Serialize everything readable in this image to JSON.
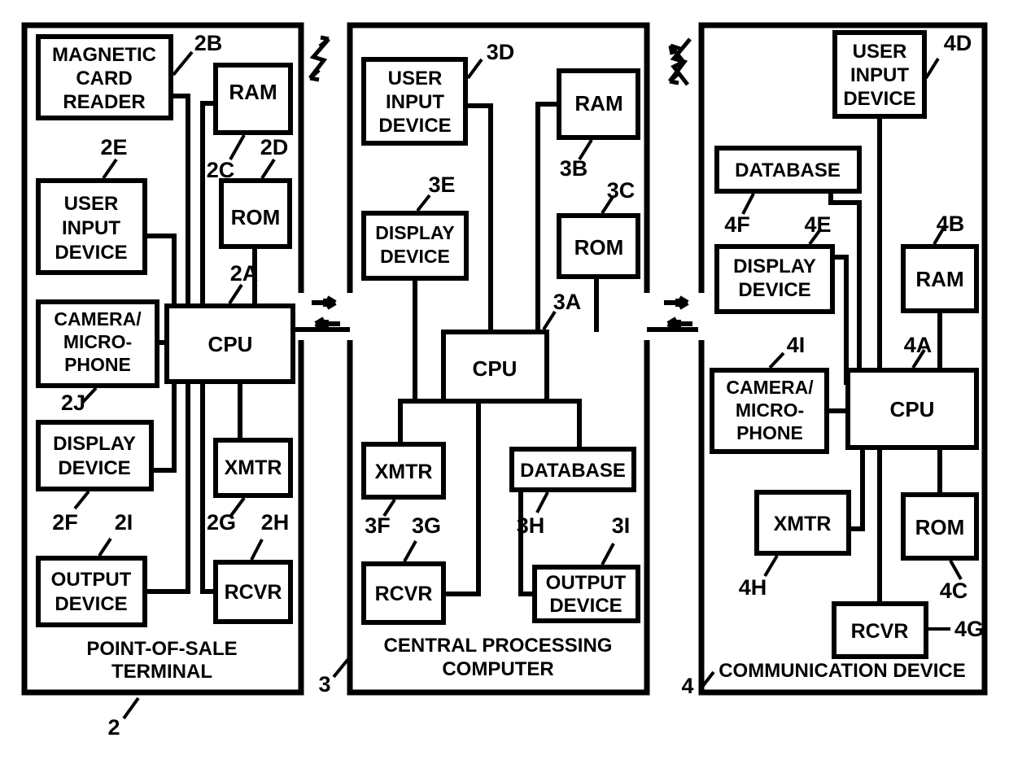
{
  "figure": {
    "type": "patent-block-diagram",
    "title": "",
    "panels": [
      {
        "id": "pos",
        "name": "point-of-sale-terminal",
        "title_lines": [
          "POINT-OF-SALE",
          "TERMINAL"
        ],
        "ref": "2",
        "blocks": [
          {
            "key": "magcard",
            "label_lines": [
              "MAGNETIC",
              "CARD",
              "READER"
            ],
            "ref": "2B"
          },
          {
            "key": "ram",
            "label_lines": [
              "RAM"
            ],
            "ref": "2C"
          },
          {
            "key": "rom",
            "label_lines": [
              "ROM"
            ],
            "ref": "2D"
          },
          {
            "key": "uid",
            "label_lines": [
              "USER",
              "INPUT",
              "DEVICE"
            ],
            "ref": "2E"
          },
          {
            "key": "cpu",
            "label_lines": [
              "CPU"
            ],
            "ref": "2A"
          },
          {
            "key": "cam",
            "label_lines": [
              "CAMERA/",
              "MICRO-",
              "PHONE"
            ],
            "ref": "2J"
          },
          {
            "key": "display",
            "label_lines": [
              "DISPLAY",
              "DEVICE"
            ],
            "ref": "2F"
          },
          {
            "key": "xmtr",
            "label_lines": [
              "XMTR"
            ],
            "ref": "2G"
          },
          {
            "key": "output",
            "label_lines": [
              "OUTPUT",
              "DEVICE"
            ],
            "ref": "2I"
          },
          {
            "key": "rcvr",
            "label_lines": [
              "RCVR"
            ],
            "ref": "2H"
          }
        ]
      },
      {
        "id": "cpc",
        "name": "central-processing-computer",
        "title_lines": [
          "CENTRAL PROCESSING",
          "COMPUTER"
        ],
        "ref": "3",
        "blocks": [
          {
            "key": "uid",
            "label_lines": [
              "USER",
              "INPUT",
              "DEVICE"
            ],
            "ref": "3D"
          },
          {
            "key": "ram",
            "label_lines": [
              "RAM"
            ],
            "ref": "3B"
          },
          {
            "key": "rom",
            "label_lines": [
              "ROM"
            ],
            "ref": "3C"
          },
          {
            "key": "display",
            "label_lines": [
              "DISPLAY",
              "DEVICE"
            ],
            "ref": "3E"
          },
          {
            "key": "cpu",
            "label_lines": [
              "CPU"
            ],
            "ref": "3A"
          },
          {
            "key": "xmtr",
            "label_lines": [
              "XMTR"
            ],
            "ref": "3F"
          },
          {
            "key": "database",
            "label_lines": [
              "DATABASE"
            ],
            "ref": "3H"
          },
          {
            "key": "rcvr",
            "label_lines": [
              "RCVR"
            ],
            "ref": "3G"
          },
          {
            "key": "output",
            "label_lines": [
              "OUTPUT",
              "DEVICE"
            ],
            "ref": "3I"
          }
        ]
      },
      {
        "id": "comm",
        "name": "communication-device",
        "title_lines": [
          "COMMUNICATION DEVICE"
        ],
        "ref": "4",
        "blocks": [
          {
            "key": "uid",
            "label_lines": [
              "USER",
              "INPUT",
              "DEVICE"
            ],
            "ref": "4D"
          },
          {
            "key": "database",
            "label_lines": [
              "DATABASE"
            ],
            "ref": "4F"
          },
          {
            "key": "display",
            "label_lines": [
              "DISPLAY",
              "DEVICE"
            ],
            "ref": "4E"
          },
          {
            "key": "ram",
            "label_lines": [
              "RAM"
            ],
            "ref": "4B"
          },
          {
            "key": "cam",
            "label_lines": [
              "CAMERA/",
              "MICRO-",
              "PHONE"
            ],
            "ref": "4I"
          },
          {
            "key": "cpu",
            "label_lines": [
              "CPU"
            ],
            "ref": "4A"
          },
          {
            "key": "xmtr",
            "label_lines": [
              "XMTR"
            ],
            "ref": "4H"
          },
          {
            "key": "rom",
            "label_lines": [
              "ROM"
            ],
            "ref": "4C"
          },
          {
            "key": "rcvr",
            "label_lines": [
              "RCVR"
            ],
            "ref": "4G"
          }
        ]
      }
    ],
    "links": [
      {
        "name": "pos-to-cpc-wireless",
        "symbol": "lightning-arrow-down-left"
      },
      {
        "name": "pos-to-cpc-wired",
        "symbol": "bidirectional-arrows"
      },
      {
        "name": "cpc-to-comm-wireless",
        "symbol": "lightning-arrow-double"
      },
      {
        "name": "cpc-to-comm-wired",
        "symbol": "bidirectional-arrows"
      }
    ],
    "colors": {
      "ink": "#000000",
      "paper": "#ffffff"
    }
  }
}
